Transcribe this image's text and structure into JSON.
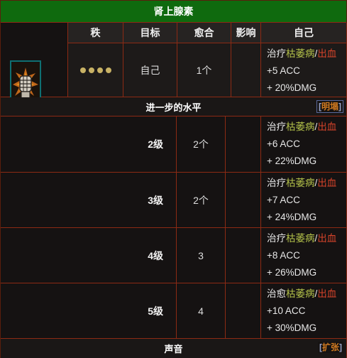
{
  "skill": {
    "title": "肾上腺素"
  },
  "columns": {
    "rank": "秩",
    "target": "目标",
    "heal": "愈合",
    "effect": "影响",
    "self": "自己"
  },
  "base_row": {
    "target": "自己",
    "heal": "1个",
    "effects": {
      "prefix": "治疗",
      "blight": "枯萎病",
      "sep": "/",
      "bleed": "出血",
      "line2": "+5 ACC",
      "line3": "+ 20%DMG"
    }
  },
  "upgrade_header": {
    "label": "进一步的水平",
    "toggle": "明塌",
    "open_bracket": "[",
    "close_bracket": "]"
  },
  "levels": [
    {
      "level": "2级",
      "heal": "2个",
      "prefix": "治疗",
      "blight": "枯萎病",
      "sep": "/",
      "bleed": "出血",
      "line2": "+6 ACC",
      "line3": "+ 22%DMG"
    },
    {
      "level": "3级",
      "heal": "2个",
      "prefix": "治疗",
      "blight": "枯萎病",
      "sep": "/",
      "bleed": "出血",
      "line2": "+7 ACC",
      "line3": "+ 24%DMG"
    },
    {
      "level": "4级",
      "heal": "3",
      "prefix": "治疗",
      "blight": "枯萎病",
      "sep": "/",
      "bleed": "出血",
      "line2": "+8 ACC",
      "line3": "+ 26%DMG"
    },
    {
      "level": "5级",
      "heal": "4",
      "prefix": "治愈",
      "blight": "枯萎病",
      "sep": "/",
      "bleed": "出血",
      "line2": "+10 ACC",
      "line3": "+ 30%DMG"
    }
  ],
  "sound_header": {
    "label": "声音",
    "toggle": "扩张",
    "open_bracket": "[",
    "close_bracket": "]"
  },
  "colors": {
    "title_bg": "#0f6a0e",
    "border": "#8c2a14",
    "blight": "#b4c24a",
    "bleed": "#d8442a",
    "toggle": "#d17a20"
  }
}
